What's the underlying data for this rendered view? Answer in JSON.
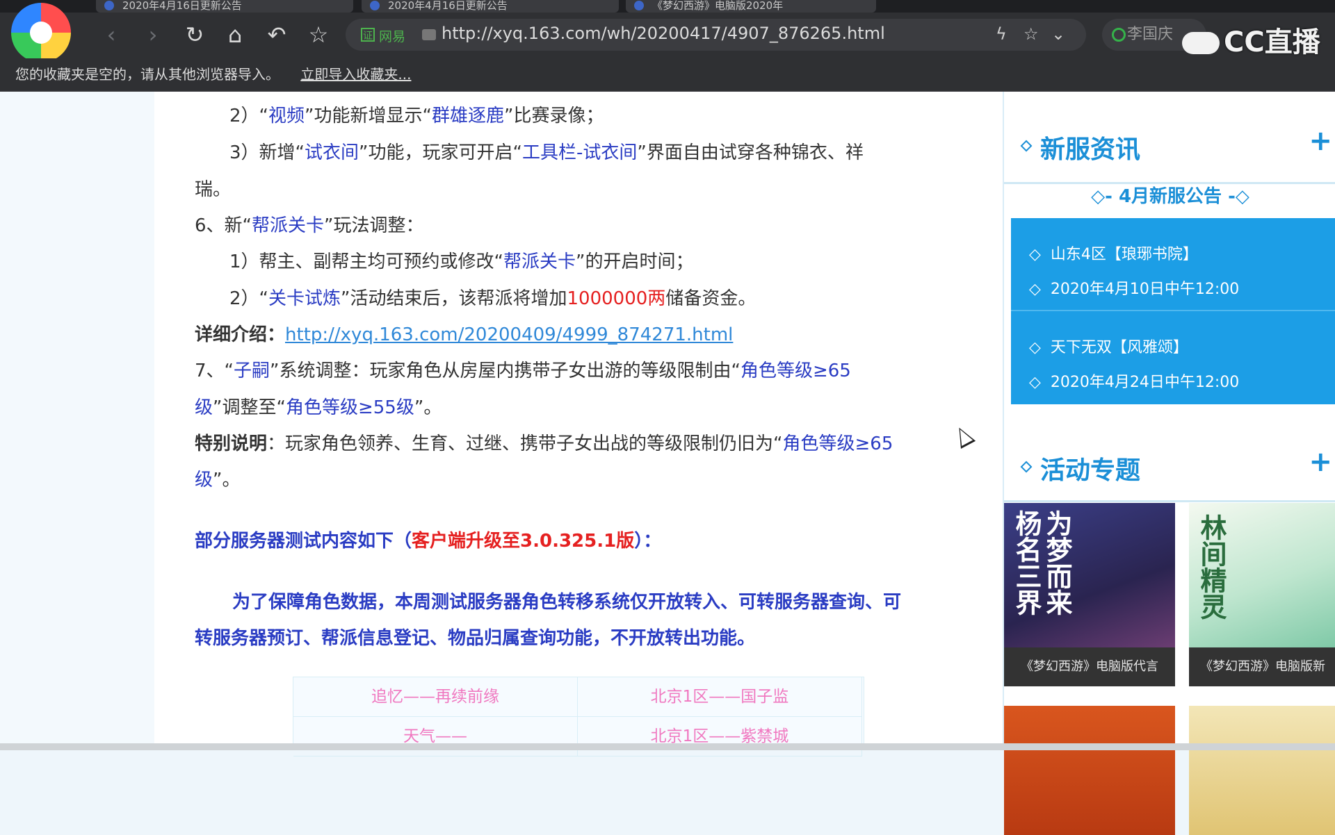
{
  "browser": {
    "tabs": [
      "2020年4月16日更新公告",
      "2020年4月16日更新公告",
      "《梦幻西游》电脑版2020年"
    ],
    "address": {
      "badge": "证",
      "site": "网易",
      "url": "http://xyq.163.com/wh/20200417/4907_876265.html"
    },
    "search_placeholder": "李国庆",
    "brand": "CC直播",
    "bookmarks_text": "您的收藏夹是空的，请从其他浏览器导入。",
    "bookmarks_link": "立即导入收藏夹..."
  },
  "article": {
    "l1": {
      "a": "2）“",
      "b": "视频",
      "c": "”功能新增显示“",
      "d": "群雄逐鹿",
      "e": "”比赛录像；"
    },
    "l2": {
      "a": "3）新增“",
      "b": "试衣间",
      "c": "”功能，玩家可开启“",
      "d": "工具栏-试衣间",
      "e": "”界面自由试穿各种锦衣、祥"
    },
    "l2b": "瑞。",
    "l3": {
      "a": "6、新“",
      "b": "帮派关卡",
      "c": "”玩法调整："
    },
    "l4": {
      "a": "1）帮主、副帮主均可预约或修改“",
      "b": "帮派关卡",
      "c": "”的开启时间；"
    },
    "l5": {
      "a": "2）“",
      "b": "关卡试炼",
      "c": "”活动结束后，该帮派将增加",
      "d": "1000000两",
      "e": "储备资金。"
    },
    "l6": {
      "label": "详细介绍：",
      "link": "http://xyq.163.com/20200409/4999_874271.html"
    },
    "l7": {
      "a": "7、“",
      "b": "子嗣",
      "c": "”系统调整：玩家角色从房屋内携带子女出游的等级限制由“",
      "d": "角色等级≥65"
    },
    "l7b": {
      "a": "级",
      "b": "”调整至“",
      "c": "角色等级≥55级",
      "d": "”。"
    },
    "l8": {
      "label": "特别说明",
      "a": "：玩家角色领养、生育、过继、携带子女出战的等级限制仍旧为“",
      "b": "角色等级≥65"
    },
    "l8b": {
      "a": "级",
      "b": "”。"
    },
    "l9": {
      "a": "部分服务器测试内容如下（",
      "b": "客户端升级至3.0.325.1版",
      "c": "）："
    },
    "l10": "为了保障角色数据，本周测试服务器角色转移系统仅开放转入、可转服务器查询、可",
    "l11": "转服务器预订、帮派信息登记、物品归属查询功能，不开放转出功能。",
    "table": [
      [
        "追忆——再续前缘",
        "北京1区——国子监"
      ],
      [
        "天气——",
        "北京1区——紫禁城"
      ]
    ]
  },
  "sidebar": {
    "news": {
      "title": "新服资讯",
      "plus": "+"
    },
    "notice_title": "◇- 4月新服公告 -◇",
    "servers": [
      {
        "name": "山东4区【琅琊书院】",
        "time": "2020年4月10日中午12:00"
      },
      {
        "name": "天下无双【风雅颂】",
        "time": "2020年4月24日中午12:00"
      }
    ],
    "topics": {
      "title": "活动专题",
      "plus": "+"
    },
    "thumbs": [
      {
        "art": "为梦而来 杨名三界",
        "caption": "《梦幻西游》电脑版代言"
      },
      {
        "art": "林间精灵",
        "caption": "《梦幻西游》电脑版新"
      }
    ]
  },
  "colors": {
    "accent": "#1b8fd7",
    "link_blue": "#2a3cc3",
    "red": "#e52020"
  }
}
